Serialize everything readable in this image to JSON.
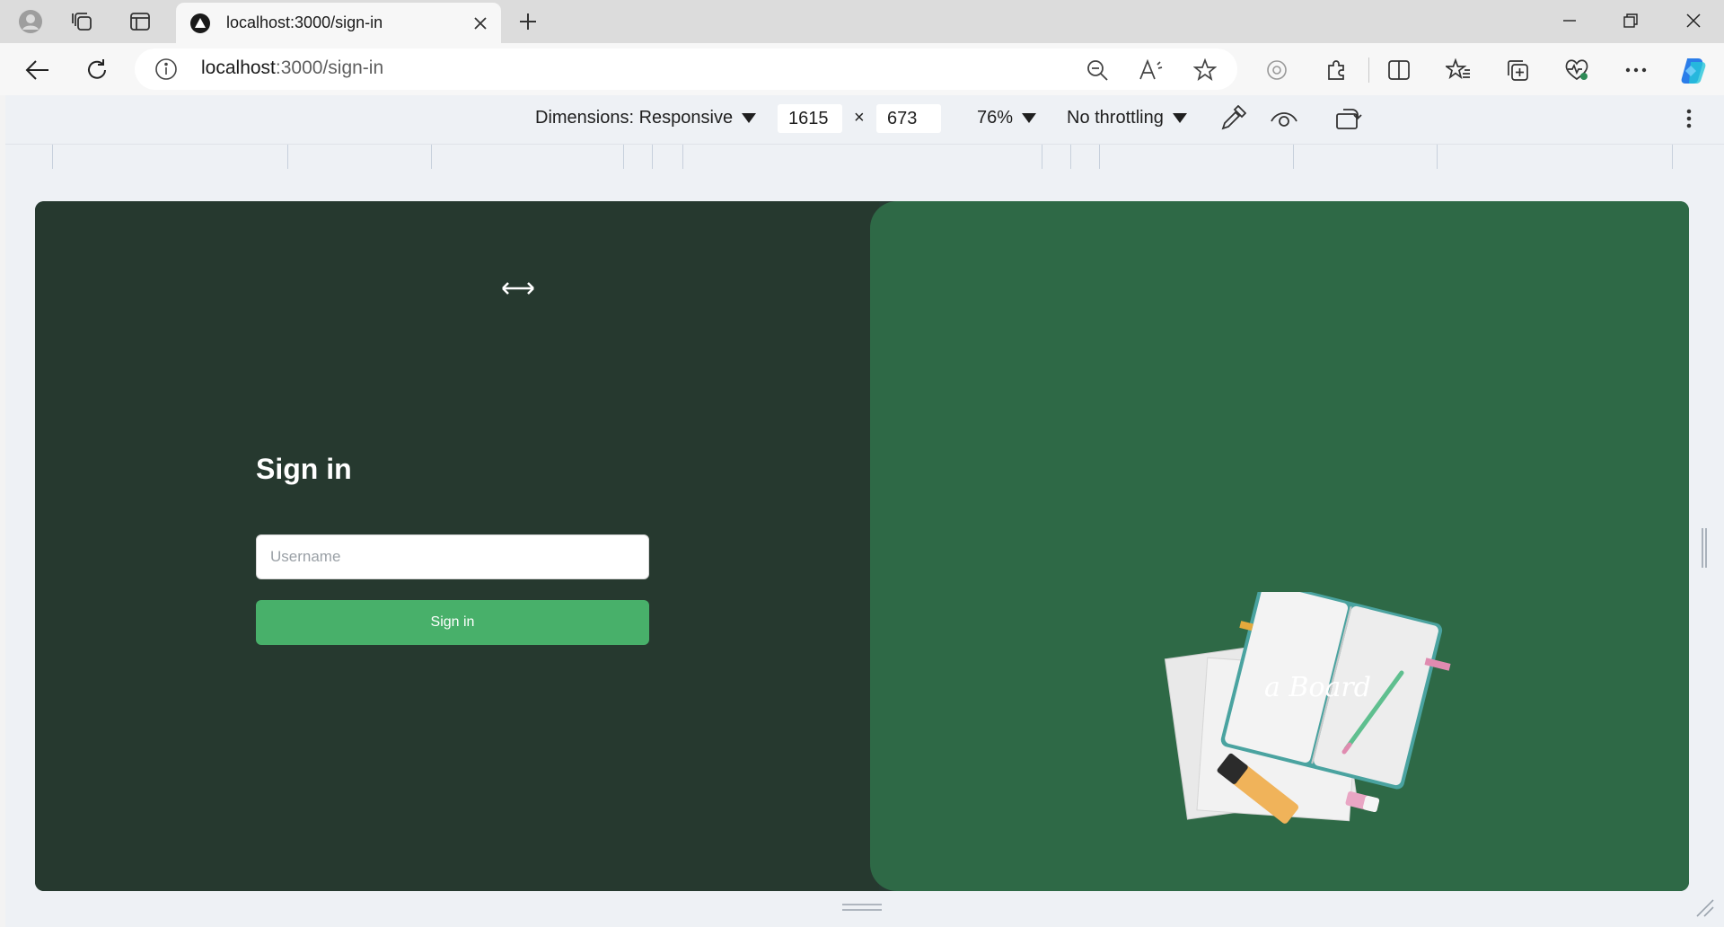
{
  "browser": {
    "tab_title": "localhost:3000/sign-in",
    "url_host": "localhost",
    "url_rest": ":3000/sign-in"
  },
  "device_toolbar": {
    "dimensions_label": "Dimensions: Responsive",
    "width_value": "1615",
    "times_sign": "×",
    "height_value": "673",
    "zoom_label": "76%",
    "throttling_label": "No throttling"
  },
  "page": {
    "signin_title": "Sign in",
    "username_placeholder": "Username",
    "signin_button": "Sign in",
    "brand_text": "a Board",
    "colors": {
      "left_panel": "#26392f",
      "right_panel": "#2e6946",
      "button": "#48b06a"
    }
  },
  "icons": {
    "profile": "profile-icon",
    "workspaces": "workspaces-icon",
    "tab_actions": "vertical-tabs-icon",
    "back": "back-arrow-icon",
    "reload": "reload-icon",
    "site_info": "info-icon",
    "zoom_out": "zoom-out-icon",
    "read_aloud": "read-aloud-icon",
    "favorite": "star-icon",
    "extensions": "puzzle-icon",
    "split_screen": "split-screen-icon",
    "favorites_list": "favorites-icon",
    "collections": "collections-icon",
    "browser_essentials": "heart-pulse-icon",
    "more": "more-icon",
    "copilot": "copilot-icon"
  }
}
